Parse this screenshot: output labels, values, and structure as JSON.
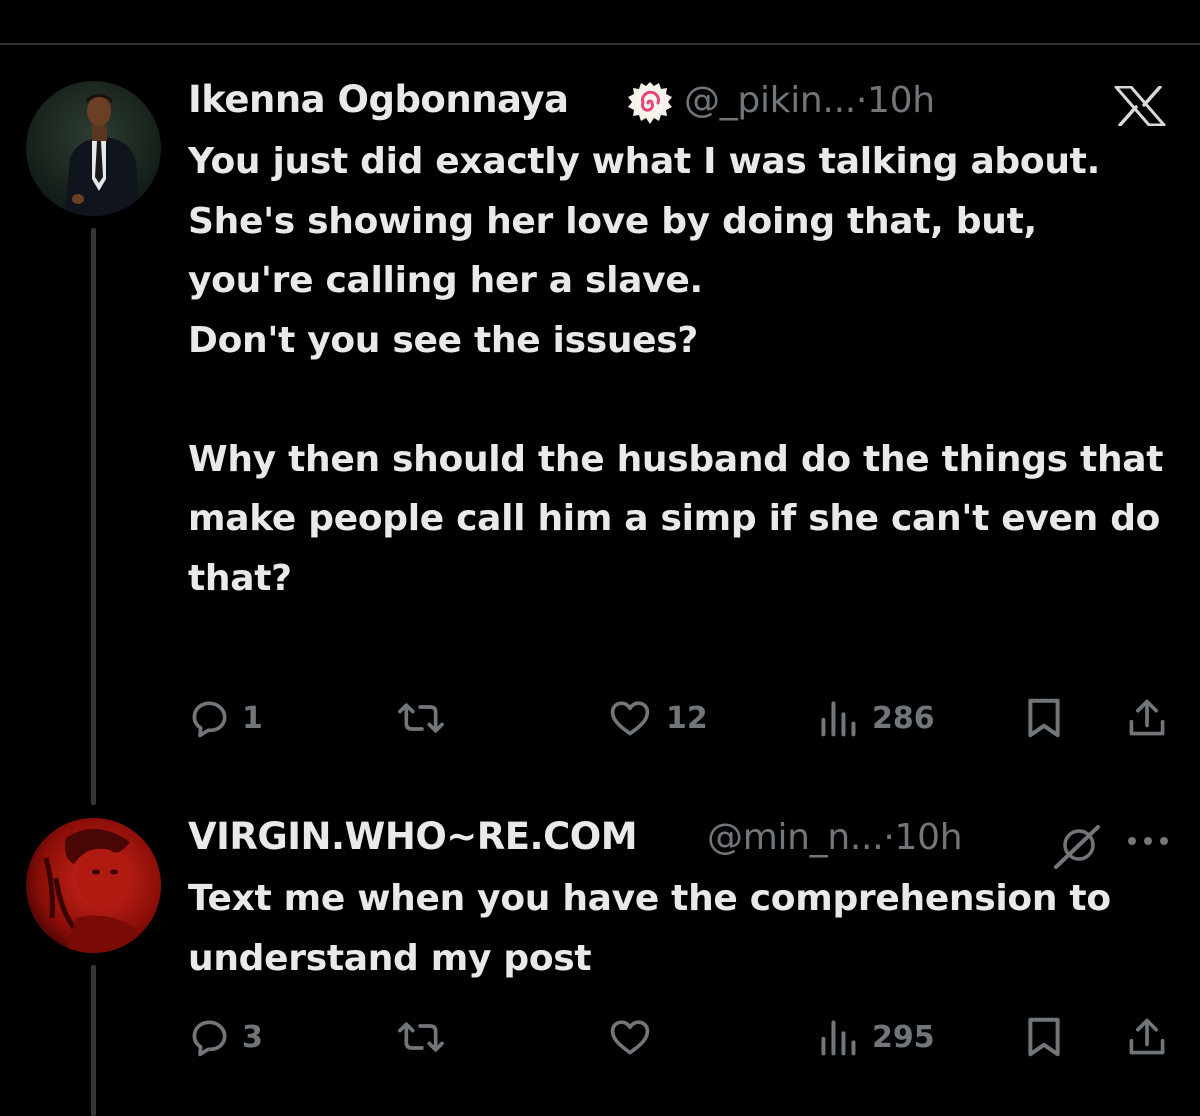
{
  "tweets": [
    {
      "author_name": "Ikenna Ogbonnaya",
      "handle": "@_pikin...",
      "time": "·10h",
      "text": "You just did exactly what I was talking about.\nShe's showing her love by doing that, but, you're calling her a slave.\nDon't you see the issues?\n\nWhy then should the husband do the things that make people call him a simp if she can't even do that?",
      "replies": "1",
      "likes": "12",
      "views": "286",
      "corner_icon": "x-logo-icon",
      "badge_icon": "fish-cake-emoji-icon"
    },
    {
      "author_name": "VIRGIN.WHO~RE.COM",
      "handle": "@min_n...",
      "time": "·10h",
      "text": "Text me when you have the comprehension to understand my post",
      "replies": "3",
      "likes": "",
      "views": "295",
      "corner_icon": "more-icon",
      "badge_icon": "grok-icon"
    }
  ],
  "colors": {
    "background": "#000000",
    "text_primary": "#e7e9ea",
    "text_secondary": "#71767b",
    "divider": "#2f3336"
  }
}
